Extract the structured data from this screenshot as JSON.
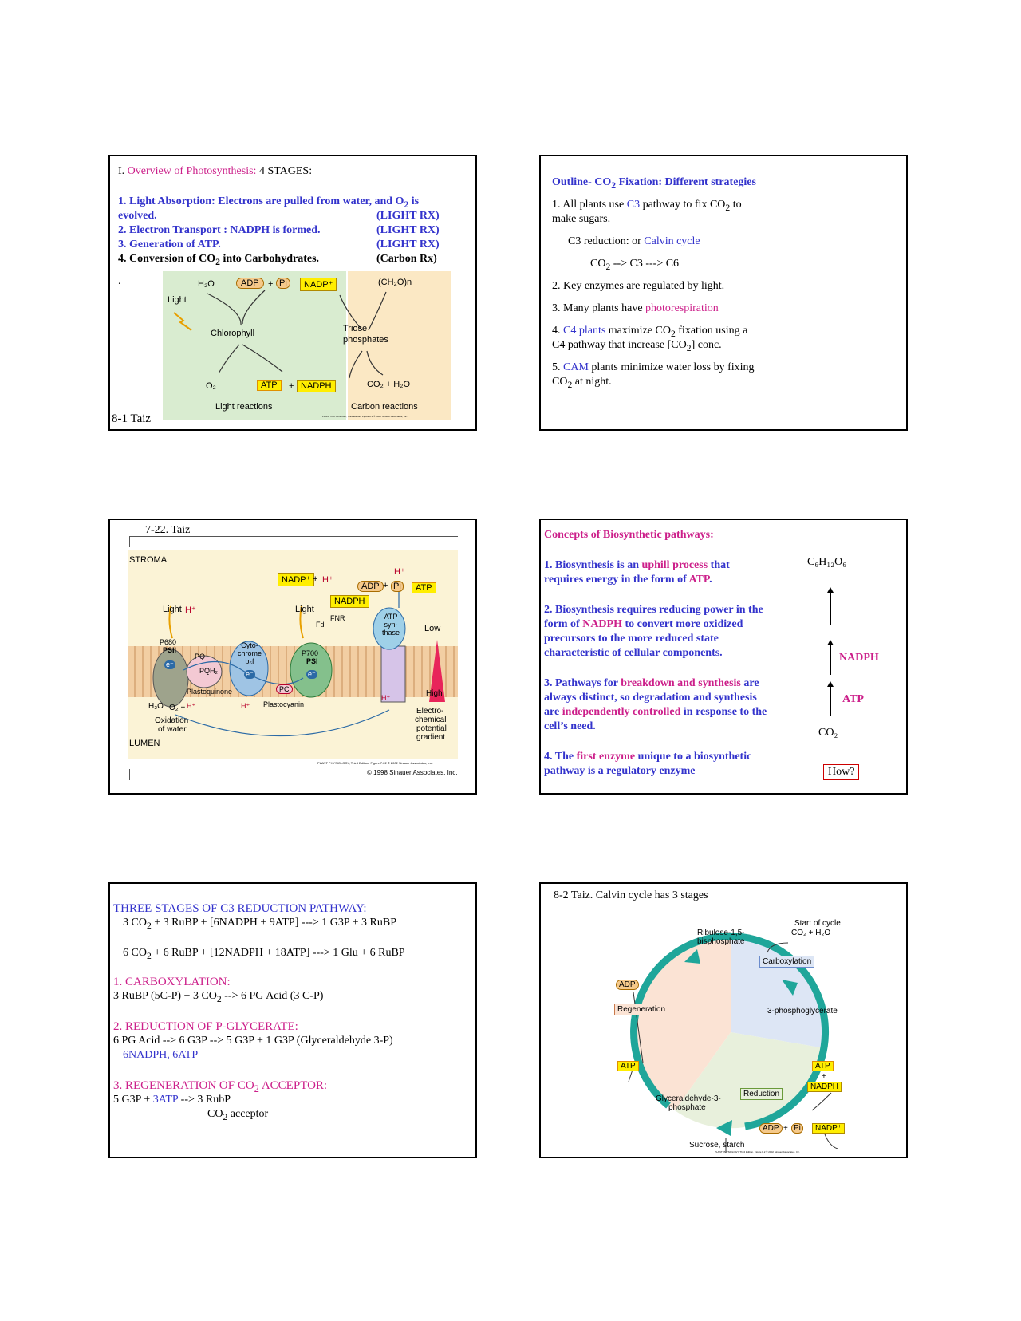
{
  "slide1": {
    "title_prefix": "I. ",
    "title_colored": "Overview of Photosynthesis:",
    "title_suffix": "  4 STAGES:",
    "line1a": "1. Light Absorption:  Electrons are pulled from water, and O",
    "line1_sub": "2",
    "line1b": " is",
    "line2": "evolved.",
    "line2_tag": "(LIGHT RX)",
    "line3": "2. Electron Transport : NADPH is formed.",
    "line3_tag": "(LIGHT RX)",
    "line4": "3. Generation of ATP.",
    "line4_tag": "(LIGHT RX)",
    "line5a": "4. Conversion of CO",
    "line5_sub": "2",
    "line5b": " into Carbohydrates.",
    "line5_tag": "(Carbon Rx)",
    "dot": ".",
    "caption": "8-1 Taiz",
    "fig": {
      "h2o": "H₂O",
      "adp": "ADP",
      "plus": "+",
      "pi": "Pi",
      "nadp": "NADP⁺",
      "ch2o": "(CH₂O)n",
      "light": "Light",
      "chlorophyll": "Chlorophyll",
      "triose": "Triose",
      "phosphates": "phosphates",
      "o2": "O₂",
      "atp": "ATP",
      "nadph": "NADPH",
      "co2_h2o": "CO₂ + H₂O",
      "light_reactions": "Light reactions",
      "carbon_reactions": "Carbon reactions",
      "credit": "PLANT PHYSIOLOGY, Third Edition, Figure 8.1 © 2002 Sinauer Associates, Inc."
    }
  },
  "slide2": {
    "title_a": "Outline- CO",
    "title_sub": "2",
    "title_b": " Fixation:  Different strategies",
    "p1_a": "1.  All plants use ",
    "p1_c3": "C3",
    "p1_b": " pathway to fix CO",
    "p1_sub": "2",
    "p1_c": " to",
    "p1_line2": "make sugars.",
    "c3_a": "C3 reduction: or ",
    "c3_calvin": "Calvin cycle",
    "eq_a": "CO",
    "eq_sub": "2",
    "eq_b": " --> C3 ---> C6",
    "p2": "2. Key enzymes are regulated by light.",
    "p3_a": "3.  Many plants have ",
    "p3_b": "photorespiration",
    "p4_a": "4.  ",
    "p4_c4": "C4 plants",
    "p4_b": " maximize CO",
    "p4_sub": "2",
    "p4_c": " fixation using a",
    "p4_line2_a": "C4 pathway that increase [CO",
    "p4_line2_sub": "2",
    "p4_line2_b": "] conc.",
    "p5_a": "5.  ",
    "p5_cam": "CAM",
    "p5_b": " plants minimize water loss by fixing",
    "p5_line2_a": "CO",
    "p5_line2_sub": "2",
    "p5_line2_b": " at night."
  },
  "slide3": {
    "caption": "7-22.  Taiz",
    "fig": {
      "stroma": "STROMA",
      "lumen": "LUMEN",
      "nadp": "NADP⁺",
      "plus": "+",
      "h": "H⁺",
      "adp": "ADP",
      "pi": "Pi",
      "atp": "ATP",
      "nadph": "NADPH",
      "light": "Light",
      "fnr": "FNR",
      "fd": "Fd",
      "atp_synthase": "ATP syn- thase",
      "low": "Low",
      "p680": "P680",
      "psii": "PSII",
      "pq": "PQ",
      "pqh2": "PQH₂",
      "cytochrome": "Cyto- chrome b₆f",
      "p700": "P700",
      "psi": "PSI",
      "e": "e⁻",
      "pc": "PC",
      "plastoquinone": "Plastoquinone",
      "plastocyanin": "Plastocyanin",
      "h2o": "H₂O",
      "o2": "O₂ +",
      "oxidation": "Oxidation",
      "of_water": "of water",
      "high": "High",
      "electro1": "Electro-",
      "electro2": "chemical",
      "electro3": "potential",
      "electro4": "gradient",
      "credit1": "PLANT PHYSIOLOGY, Third Edition, Figure 7.22 © 2002 Sinauer Associates, Inc.",
      "credit2": "© 1998 Sinauer Associates, Inc."
    }
  },
  "slide4": {
    "title": "Concepts of Biosynthetic pathways:",
    "p1_a": "1.  Biosynthesis is an ",
    "p1_b": "uphill process",
    "p1_c": " that",
    "p1_line2_a": "requires energy in the form of ",
    "p1_line2_b": "ATP",
    "p1_line2_c": ".",
    "p2_a": "2.  Biosynthesis requires reducing power in the",
    "p2_line2_a": "form of ",
    "p2_line2_b": "NADPH",
    "p2_line2_c": " to convert more oxidized",
    "p2_line3": "precursors to the more  reduced state",
    "p2_line4": "characteristic of cellular components.",
    "p3_a": "3.  Pathways for ",
    "p3_b": "breakdown and synthesis",
    "p3_c": " are",
    "p3_line2": "always distinct, so degradation and synthesis",
    "p3_line3_a": "are ",
    "p3_line3_b": "independently controlled",
    "p3_line3_c": " in response to the",
    "p3_line4": "cell’s need.",
    "p4_a": "4.  The ",
    "p4_b": "first enzyme",
    "p4_c": " unique to a biosynthetic",
    "p4_line2": "pathway is a regulatory enzyme",
    "glucose": "C₆H₁₂O₆",
    "nadph": "NADPH",
    "atp": "ATP",
    "co2": "CO₂",
    "how": "How?"
  },
  "slide5": {
    "title": "THREE STAGES OF C3 REDUCTION PATHWAY:",
    "eq1_a": "3 CO",
    "eq1_sub": "2",
    "eq1_b": " + 3 RuBP + [6NADPH + 9ATP] ---> 1 G3P + 3 RuBP",
    "eq2_a": "6 CO",
    "eq2_sub": "2",
    "eq2_b": " + 6 RuBP + [12NADPH + 18ATP] ---> 1 Glu + 6 RuBP",
    "s1": "1. CARBOXYLATION:",
    "s1_eq_a": "3 RuBP (5C-P) + 3 CO",
    "s1_eq_sub": "2",
    "s1_eq_b": " --> 6 PG Acid (3 C-P)",
    "s2": "2. REDUCTION OF P-GLYCERATE:",
    "s2_eq": "6 PG Acid --> 6 G3P --> 5 G3P + 1 G3P (Glyceraldehyde 3-P)",
    "s2_note": "6NADPH, 6ATP",
    "s3_a": "3. REGENERATION OF CO",
    "s3_sub": "2",
    "s3_b": " ACCEPTOR:",
    "s3_eq_a": "5 G3P  + ",
    "s3_eq_atp": "3ATP",
    "s3_eq_b": " --> 3 RubP",
    "s3_note_a": "CO",
    "s3_note_sub": "2",
    "s3_note_b": " acceptor"
  },
  "slide6": {
    "title": "8-2 Taiz.  Calvin cycle has 3 stages",
    "fig": {
      "rubp1": "Ribulose-1,5-",
      "rubp2": "bisphosphate",
      "start1": "Start of cycle",
      "start2": "CO₂ + H₂O",
      "carboxylation": "Carboxylation",
      "adp": "ADP",
      "regeneration": "Regeneration",
      "pga": "3-phosphoglycerate",
      "atp": "ATP",
      "plus": "+",
      "nadph": "NADPH",
      "reduction": "Reduction",
      "g3p1": "Glyceraldehyde-3-",
      "g3p2": "phosphate",
      "pi": "Pi",
      "nadp": "NADP⁺",
      "sucrose": "Sucrose, starch",
      "credit": "PLANT PHYSIOLOGY, Third Edition, Figure 8.2 © 2002 Sinauer Associates, Inc."
    }
  }
}
